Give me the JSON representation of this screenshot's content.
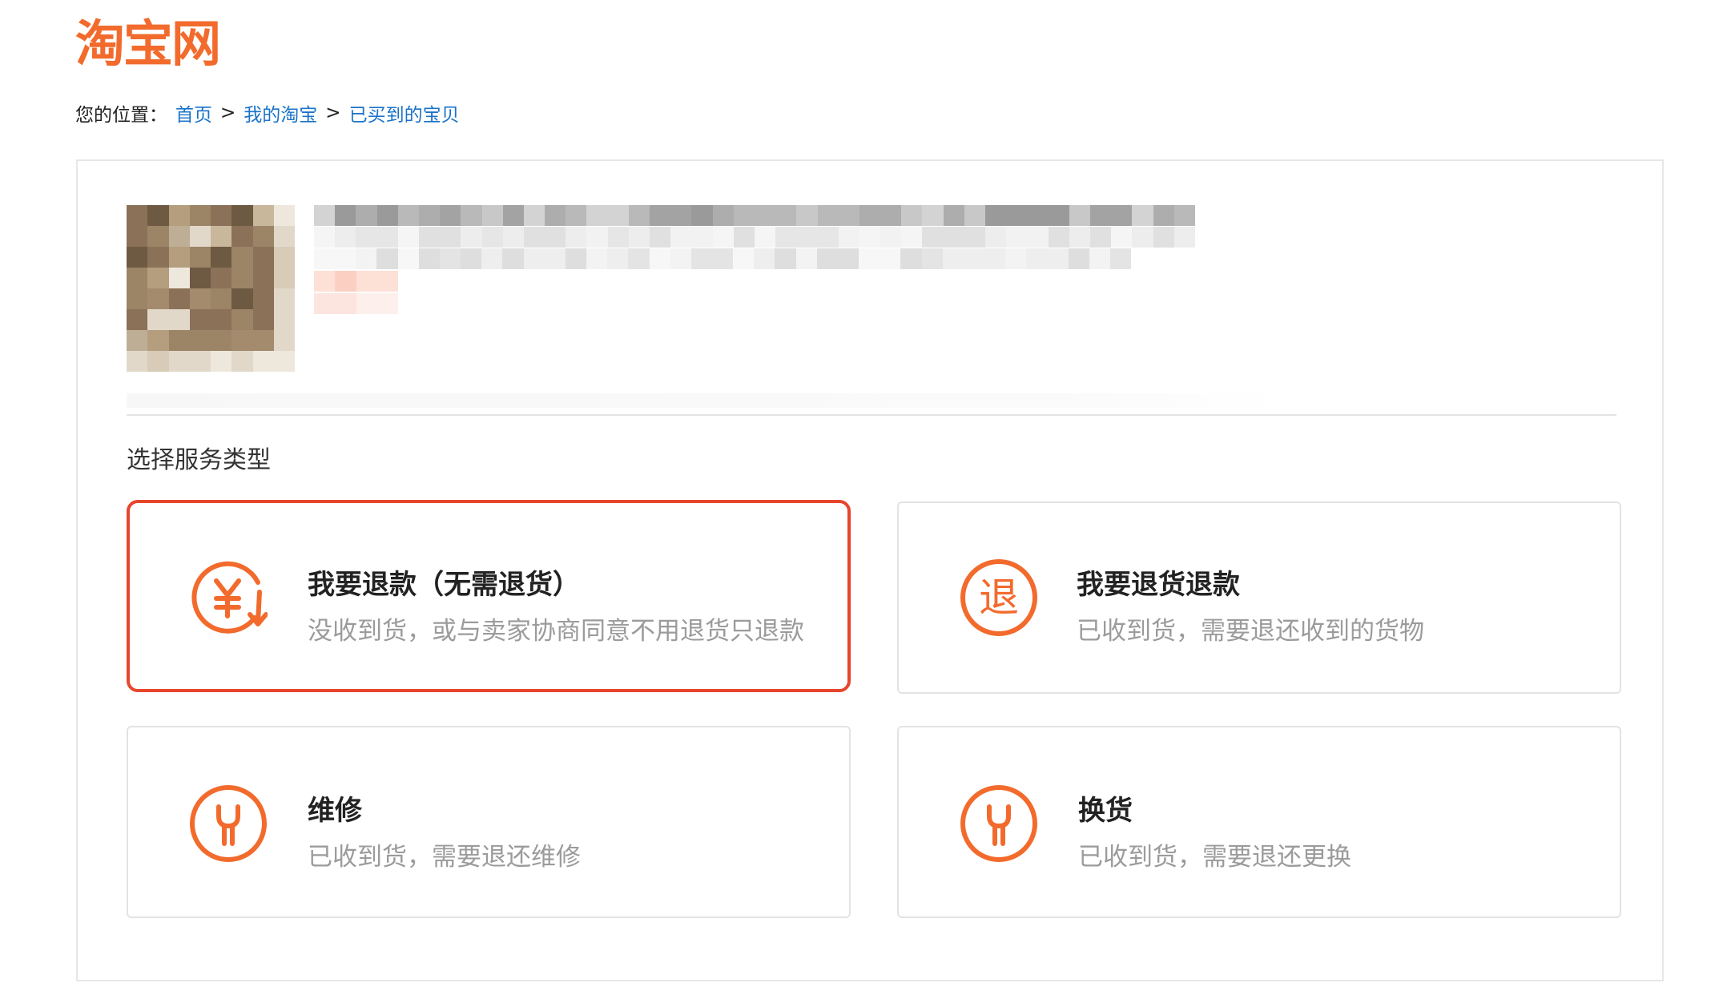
{
  "header": {
    "logo_text": "淘宝网",
    "brand_color": "#f26b2d"
  },
  "breadcrumb": {
    "prefix": "您的位置：",
    "separator": ">",
    "items": [
      "首页",
      "我的淘宝",
      "已买到的宝贝"
    ]
  },
  "section": {
    "title": "选择服务类型"
  },
  "services": [
    {
      "title": "我要退款（无需退货）",
      "desc": "没收到货，或与卖家协商同意不用退货只退款",
      "icon": "refund-yen-icon",
      "selected": true
    },
    {
      "title": "我要退货退款",
      "desc": "已收到货，需要退还收到的货物",
      "icon": "return-tui-icon",
      "selected": false
    },
    {
      "title": "维修",
      "desc": "已收到货，需要退还维修",
      "icon": "wrench-icon",
      "selected": false
    },
    {
      "title": "换货",
      "desc": "已收到货，需要退还更换",
      "icon": "wrench-icon",
      "selected": false
    }
  ],
  "colors": {
    "accent": "#f26b2d",
    "selected_border": "#e8452e",
    "link": "#1a73c8"
  }
}
